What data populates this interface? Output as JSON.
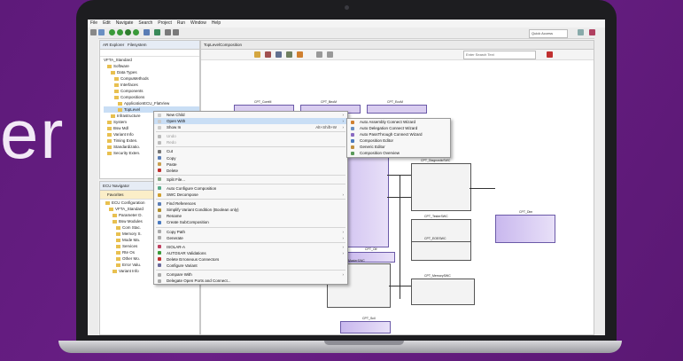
{
  "background": {
    "partial_word": "er"
  },
  "menubar": [
    "File",
    "Edit",
    "Navigate",
    "Search",
    "Project",
    "Run",
    "Window",
    "Help"
  ],
  "toolbar": {
    "quick_access": "Quick Access"
  },
  "explorer": {
    "tabs": [
      "AR Explorer",
      "Filesystem"
    ],
    "root": "VFTA_Standard",
    "items": [
      "Software",
      "Data Types",
      "CompuMethods",
      "Interfaces",
      "Components",
      "Compositions",
      "ApplicationECU_FlatView",
      "TopLevel",
      "Infrastructure",
      "System",
      "Bsw Mdl",
      "Variant Info",
      "Timing Exten.",
      "Standardizatio.",
      "Security Exten."
    ]
  },
  "ecu_navigator": {
    "title": "ECU Navigator",
    "favorites": "Favorites",
    "items": [
      "ECU Configuration",
      "VFTA_Standard",
      "Parameter D.",
      "Bsw Modules",
      "Com Stac.",
      "Memory S.",
      "Mode Ma.",
      "Services",
      "Rte Os",
      "Other Mo.",
      "Error Valu.",
      "Variant Info"
    ]
  },
  "editor": {
    "tab": "TopLevelComposition",
    "filter_placeholder": "Enter Search Text",
    "blocks": [
      "CPT_CoreM",
      "CPT_BeoM",
      "CPT_EcoM",
      "CPT_Gen",
      "CPT_DiagnosticSWC",
      "CPT_TesterSWC",
      "CPT_Dim",
      "CPT_Weight",
      "CPT_EOESWC",
      "CPT_Olf",
      "CPT_MasterSWC",
      "CPT_MemorySWC",
      "CPT_Scil",
      "CPT_Aldi"
    ]
  },
  "context_menu": {
    "items": [
      {
        "label": "New Child",
        "submenu": true
      },
      {
        "label": "Open With",
        "submenu": true,
        "selected": true
      },
      {
        "label": "Show In",
        "shortcut": "Alt+Shift+W",
        "submenu": true
      },
      {
        "label": "Undo",
        "disabled": true
      },
      {
        "label": "Redo",
        "disabled": true
      },
      {
        "label": "Cut"
      },
      {
        "label": "Copy"
      },
      {
        "label": "Paste"
      },
      {
        "label": "Delete"
      },
      {
        "label": "Split File..."
      },
      {
        "label": "Auto Configure Composition"
      },
      {
        "label": "SWC Decompose",
        "submenu": true
      },
      {
        "label": "Find References"
      },
      {
        "label": "Simplify Variant Condition (Boolean only)"
      },
      {
        "label": "Rename"
      },
      {
        "label": "Create SubComposition"
      },
      {
        "label": "Copy Path",
        "submenu": true
      },
      {
        "label": "Generate",
        "submenu": true
      },
      {
        "label": "ISOLAR-A",
        "submenu": true
      },
      {
        "label": "AUTOSAR Validations",
        "submenu": true
      },
      {
        "label": "Delete Erroneous Connectors"
      },
      {
        "label": "Configure Variant"
      },
      {
        "label": "Compare With",
        "submenu": true
      },
      {
        "label": "Delegate Open Ports and Connect..."
      }
    ]
  },
  "submenu": {
    "items": [
      "Auto Assembly Connect Wizard",
      "Auto Delegation Connect Wizard",
      "Auto PassThrough Connect Wizard",
      "Composition Editor",
      "Generic Editor",
      "Composition Overview"
    ]
  }
}
